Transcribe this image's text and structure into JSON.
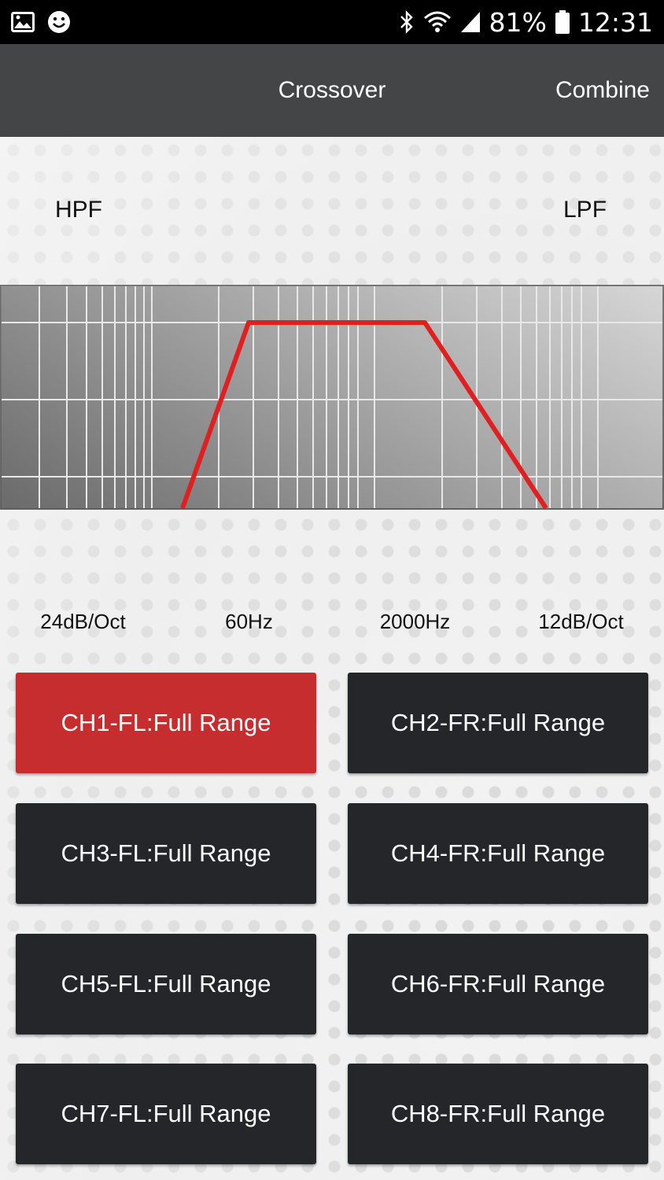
{
  "status_bar": {
    "battery": "81%",
    "time": "12:31"
  },
  "header": {
    "title": "Crossover",
    "combine_label": "Combine"
  },
  "filters": {
    "hpf_label": "HPF",
    "lpf_label": "LPF",
    "hpf_slope": "24dB/Oct",
    "hpf_freq": "60Hz",
    "lpf_freq": "2000Hz",
    "lpf_slope": "12dB/Oct"
  },
  "channels": [
    {
      "label": "CH1-FL:Full Range",
      "active": true
    },
    {
      "label": "CH2-FR:Full Range",
      "active": false
    },
    {
      "label": "CH3-FL:Full Range",
      "active": false
    },
    {
      "label": "CH4-FR:Full Range",
      "active": false
    },
    {
      "label": "CH5-FL:Full Range",
      "active": false
    },
    {
      "label": "CH6-FR:Full Range",
      "active": false
    },
    {
      "label": "CH7-FL:Full Range",
      "active": false
    },
    {
      "label": "CH8-FR:Full Range",
      "active": false
    }
  ],
  "colors": {
    "accent": "#c62d2f",
    "button_bg": "#24262a",
    "header_bg": "#444547",
    "curve": "#e02020"
  }
}
